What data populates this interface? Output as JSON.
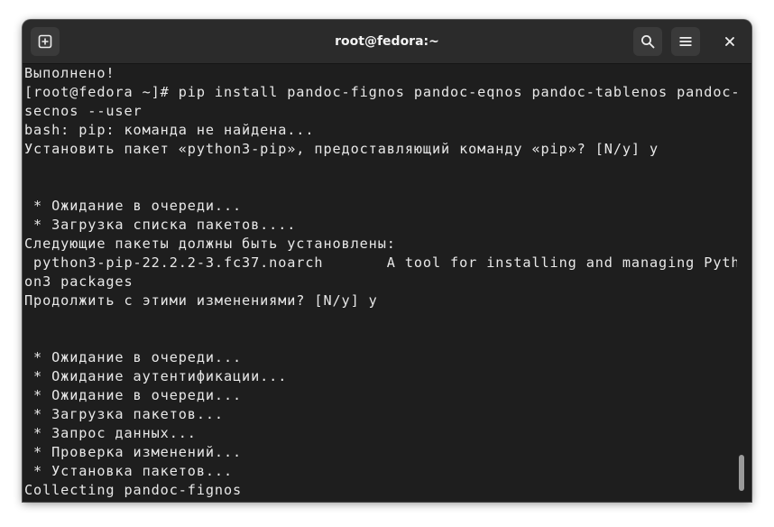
{
  "window": {
    "title": "root@fedora:~"
  },
  "icons": {
    "new_tab": "new-tab-icon",
    "search": "search-icon",
    "menu": "hamburger-menu-icon",
    "close": "close-icon"
  },
  "terminal": {
    "lines": [
      "Выполнено!",
      "[root@fedora ~]# pip install pandoc-fignos pandoc-eqnos pandoc-tablenos pandoc-",
      "secnos --user",
      "bash: pip: команда не найдена...",
      "Установить пакет «python3-pip», предоставляющий команду «pip»? [N/y] y",
      "",
      "",
      " * Ожидание в очереди...",
      " * Загрузка списка пакетов....",
      "Следующие пакеты должны быть установлены:",
      " python3-pip-22.2.2-3.fc37.noarch       A tool for installing and managing Pyth",
      "on3 packages",
      "Продолжить с этими изменениями? [N/y] y",
      "",
      "",
      " * Ожидание в очереди...",
      " * Ожидание аутентификации...",
      " * Ожидание в очереди...",
      " * Загрузка пакетов...",
      " * Запрос данных...",
      " * Проверка изменений...",
      " * Установка пакетов...",
      "Collecting pandoc-fignos"
    ]
  }
}
